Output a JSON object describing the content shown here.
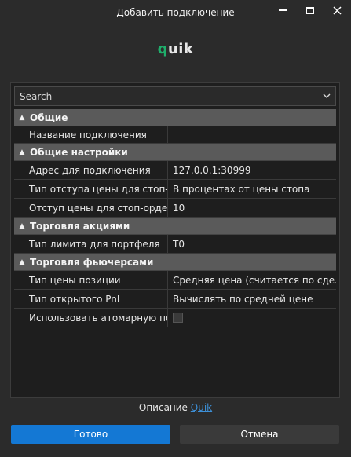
{
  "window": {
    "title": "Добавить подключение"
  },
  "logo": {
    "q": "q",
    "rest": "uik"
  },
  "search": {
    "value": "Search"
  },
  "grid": {
    "cat_general": "Общие",
    "conn_name_label": "Название подключения",
    "conn_name_value": "",
    "cat_general_settings": "Общие настройки",
    "address_label": "Адрес для подключения",
    "address_value": "127.0.0.1:30999",
    "stop_offset_type_label": "Тип отступа цены для стоп-ордера",
    "stop_offset_type_value": "В процентах от цены стопа",
    "stop_offset_label": "Отступ цены для стоп-ордера",
    "stop_offset_value": "10",
    "cat_stocks": "Торговля акциями",
    "portfolio_limit_label": "Тип лимита для портфеля",
    "portfolio_limit_value": "T0",
    "cat_futures": "Торговля фьючерсами",
    "position_price_label": "Тип цены позиции",
    "position_price_value": "Средняя цена (считается по сделкам)",
    "open_pnl_label": "Тип открытого PnL",
    "open_pnl_value": "Вычислять по средней цене",
    "atomic_label": "Использовать атомарную подачу заявок",
    "atomic_checked": false
  },
  "description": {
    "prefix": "Описание",
    "link": "Quik"
  },
  "buttons": {
    "ok": "Готово",
    "cancel": "Отмена"
  },
  "colors": {
    "accent": "#1478d4",
    "logo_green": "#1fae6b",
    "background": "#2b2b2b"
  }
}
